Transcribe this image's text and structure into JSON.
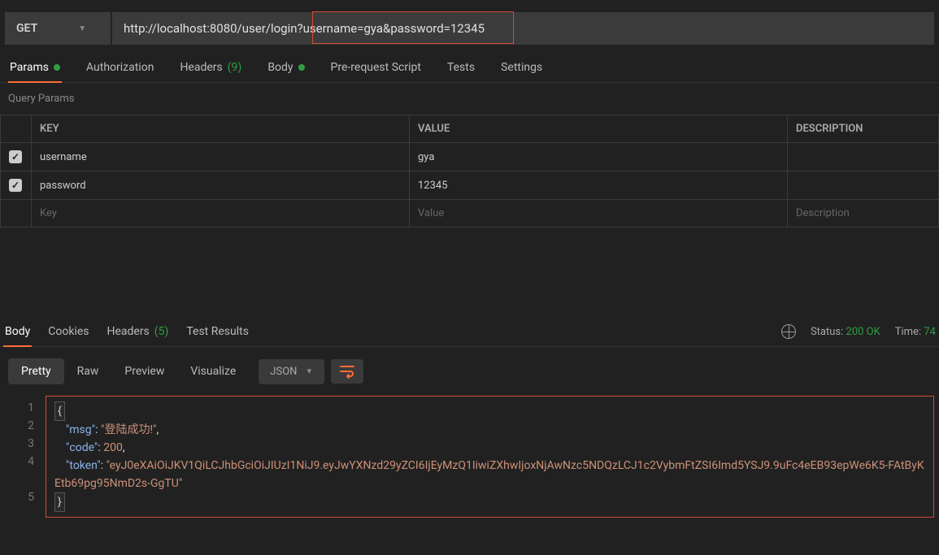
{
  "request": {
    "method": "GET",
    "url": "http://localhost:8080/user/login?username=gya&password=12345"
  },
  "tabs": {
    "params": "Params",
    "authorization": "Authorization",
    "headers": "Headers",
    "headers_count": "(9)",
    "body": "Body",
    "prerequest": "Pre-request Script",
    "tests": "Tests",
    "settings": "Settings"
  },
  "query_params_label": "Query Params",
  "params_headers": {
    "key": "KEY",
    "value": "VALUE",
    "description": "DESCRIPTION"
  },
  "params": [
    {
      "enabled": true,
      "key": "username",
      "value": "gya"
    },
    {
      "enabled": true,
      "key": "password",
      "value": "12345"
    }
  ],
  "placeholders": {
    "key": "Key",
    "value": "Value",
    "description": "Description"
  },
  "response_tabs": {
    "body": "Body",
    "cookies": "Cookies",
    "headers": "Headers",
    "headers_count": "(5)",
    "test_results": "Test Results"
  },
  "status": {
    "label": "Status:",
    "value": "200 OK",
    "time_label": "Time:",
    "time_value": "74"
  },
  "viewmodes": {
    "pretty": "Pretty",
    "raw": "Raw",
    "preview": "Preview",
    "visualize": "Visualize",
    "format": "JSON"
  },
  "json": {
    "msg_key": "\"msg\"",
    "msg_val": "\"登陆成功!\"",
    "code_key": "\"code\"",
    "code_val": "200",
    "token_key": "\"token\"",
    "token_val": "\"eyJ0eXAiOiJKV1QiLCJhbGciOiJIUzI1NiJ9.eyJwYXNzd29yZCI6IjEyMzQ1IiwiZXhwIjoxNjAwNzc5NDQzLCJ1c2VybmFtZSI6Imd5YSJ9.9uFc4eEB93epWe6K5-FAtByKEtb69pg95NmD2s-GgTU\""
  }
}
